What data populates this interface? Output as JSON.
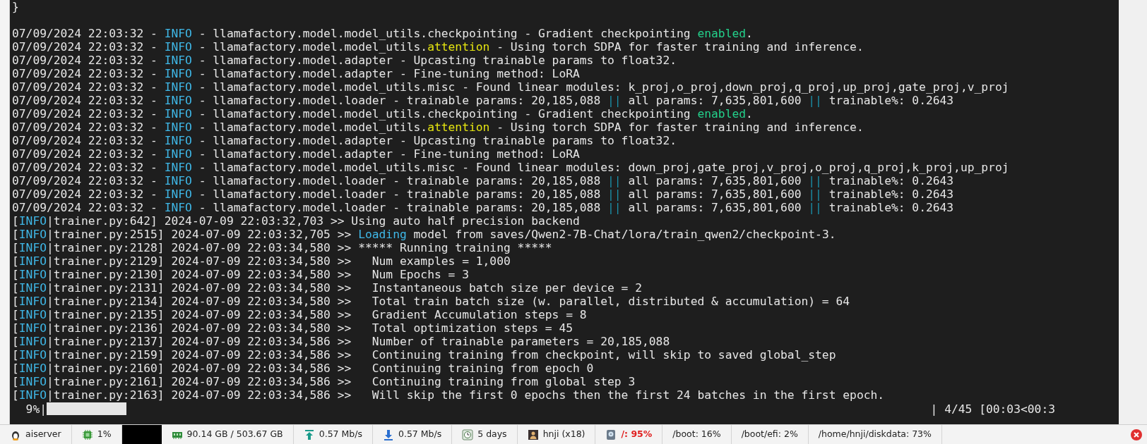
{
  "terminal": {
    "lines": [
      [
        {
          "text": "}",
          "kind": "plain"
        }
      ],
      [
        {
          "text": "07/09/2024 22:03:32 - ",
          "kind": "plain"
        },
        {
          "text": "INFO",
          "kind": "level"
        },
        {
          "text": " - llamafactory.model.model_utils.checkpointing - Gradient checkpointing ",
          "kind": "plain"
        },
        {
          "text": "enabled",
          "kind": "success"
        },
        {
          "text": ".",
          "kind": "plain"
        }
      ],
      [
        {
          "text": "07/09/2024 22:03:32 - ",
          "kind": "plain"
        },
        {
          "text": "INFO",
          "kind": "level"
        },
        {
          "text": " - llamafactory.model.model_utils.",
          "kind": "plain"
        },
        {
          "text": "attention",
          "kind": "highlight"
        },
        {
          "text": " - Using torch SDPA for faster training and inference.",
          "kind": "plain"
        }
      ],
      [
        {
          "text": "07/09/2024 22:03:32 - ",
          "kind": "plain"
        },
        {
          "text": "INFO",
          "kind": "level"
        },
        {
          "text": " - llamafactory.model.adapter - Upcasting trainable params to float32.",
          "kind": "plain"
        }
      ],
      [
        {
          "text": "07/09/2024 22:03:32 - ",
          "kind": "plain"
        },
        {
          "text": "INFO",
          "kind": "level"
        },
        {
          "text": " - llamafactory.model.adapter - Fine-tuning method: LoRA",
          "kind": "plain"
        }
      ],
      [
        {
          "text": "07/09/2024 22:03:32 - ",
          "kind": "plain"
        },
        {
          "text": "INFO",
          "kind": "level"
        },
        {
          "text": " - llamafactory.model.model_utils.misc - Found linear modules: k_proj,o_proj,down_proj,q_proj,up_proj,gate_proj,v_proj",
          "kind": "plain"
        }
      ],
      [
        {
          "text": "07/09/2024 22:03:32 - ",
          "kind": "plain"
        },
        {
          "text": "INFO",
          "kind": "level"
        },
        {
          "text": " - llamafactory.model.loader - trainable params: 20,185,088 ",
          "kind": "plain"
        },
        {
          "text": "||",
          "kind": "separator"
        },
        {
          "text": " all params: 7,635,801,600 ",
          "kind": "plain"
        },
        {
          "text": "||",
          "kind": "separator"
        },
        {
          "text": " trainable%: 0.2643",
          "kind": "plain"
        }
      ],
      [
        {
          "text": "07/09/2024 22:03:32 - ",
          "kind": "plain"
        },
        {
          "text": "INFO",
          "kind": "level"
        },
        {
          "text": " - llamafactory.model.model_utils.checkpointing - Gradient checkpointing ",
          "kind": "plain"
        },
        {
          "text": "enabled",
          "kind": "success"
        },
        {
          "text": ".",
          "kind": "plain"
        }
      ],
      [
        {
          "text": "07/09/2024 22:03:32 - ",
          "kind": "plain"
        },
        {
          "text": "INFO",
          "kind": "level"
        },
        {
          "text": " - llamafactory.model.model_utils.",
          "kind": "plain"
        },
        {
          "text": "attention",
          "kind": "highlight"
        },
        {
          "text": " - Using torch SDPA for faster training and inference.",
          "kind": "plain"
        }
      ],
      [
        {
          "text": "07/09/2024 22:03:32 - ",
          "kind": "plain"
        },
        {
          "text": "INFO",
          "kind": "level"
        },
        {
          "text": " - llamafactory.model.adapter - Upcasting trainable params to float32.",
          "kind": "plain"
        }
      ],
      [
        {
          "text": "07/09/2024 22:03:32 - ",
          "kind": "plain"
        },
        {
          "text": "INFO",
          "kind": "level"
        },
        {
          "text": " - llamafactory.model.adapter - Fine-tuning method: LoRA",
          "kind": "plain"
        }
      ],
      [
        {
          "text": "07/09/2024 22:03:32 - ",
          "kind": "plain"
        },
        {
          "text": "INFO",
          "kind": "level"
        },
        {
          "text": " - llamafactory.model.model_utils.misc - Found linear modules: down_proj,gate_proj,v_proj,o_proj,q_proj,k_proj,up_proj",
          "kind": "plain"
        }
      ],
      [
        {
          "text": "07/09/2024 22:03:32 - ",
          "kind": "plain"
        },
        {
          "text": "INFO",
          "kind": "level"
        },
        {
          "text": " - llamafactory.model.loader - trainable params: 20,185,088 ",
          "kind": "plain"
        },
        {
          "text": "||",
          "kind": "separator"
        },
        {
          "text": " all params: 7,635,801,600 ",
          "kind": "plain"
        },
        {
          "text": "||",
          "kind": "separator"
        },
        {
          "text": " trainable%: 0.2643",
          "kind": "plain"
        }
      ],
      [
        {
          "text": "07/09/2024 22:03:32 - ",
          "kind": "plain"
        },
        {
          "text": "INFO",
          "kind": "level"
        },
        {
          "text": " - llamafactory.model.loader - trainable params: 20,185,088 ",
          "kind": "plain"
        },
        {
          "text": "||",
          "kind": "separator"
        },
        {
          "text": " all params: 7,635,801,600 ",
          "kind": "plain"
        },
        {
          "text": "||",
          "kind": "separator"
        },
        {
          "text": " trainable%: 0.2643",
          "kind": "plain"
        }
      ],
      [
        {
          "text": "07/09/2024 22:03:32 - ",
          "kind": "plain"
        },
        {
          "text": "INFO",
          "kind": "level"
        },
        {
          "text": " - llamafactory.model.loader - trainable params: 20,185,088 ",
          "kind": "plain"
        },
        {
          "text": "||",
          "kind": "separator"
        },
        {
          "text": " all params: 7,635,801,600 ",
          "kind": "plain"
        },
        {
          "text": "||",
          "kind": "separator"
        },
        {
          "text": " trainable%: 0.2643",
          "kind": "plain"
        }
      ],
      [
        {
          "text": "[",
          "kind": "plain"
        },
        {
          "text": "INFO",
          "kind": "level"
        },
        {
          "text": "|trainer.py:642] 2024-07-09 22:03:32,703 >> Using auto half precision backend",
          "kind": "plain"
        }
      ],
      [
        {
          "text": "[",
          "kind": "plain"
        },
        {
          "text": "INFO",
          "kind": "level"
        },
        {
          "text": "|trainer.py:2515] 2024-07-09 22:03:32,705 >> ",
          "kind": "plain"
        },
        {
          "text": "Loading",
          "kind": "level"
        },
        {
          "text": " model from saves/Qwen2-7B-Chat/lora/train_qwen2/checkpoint-3.",
          "kind": "plain"
        }
      ],
      [
        {
          "text": "[",
          "kind": "plain"
        },
        {
          "text": "INFO",
          "kind": "level"
        },
        {
          "text": "|trainer.py:2128] 2024-07-09 22:03:34,580 >> ***** Running training *****",
          "kind": "plain"
        }
      ],
      [
        {
          "text": "[",
          "kind": "plain"
        },
        {
          "text": "INFO",
          "kind": "level"
        },
        {
          "text": "|trainer.py:2129] 2024-07-09 22:03:34,580 >>   Num examples = 1,000",
          "kind": "plain"
        }
      ],
      [
        {
          "text": "[",
          "kind": "plain"
        },
        {
          "text": "INFO",
          "kind": "level"
        },
        {
          "text": "|trainer.py:2130] 2024-07-09 22:03:34,580 >>   Num Epochs = 3",
          "kind": "plain"
        }
      ],
      [
        {
          "text": "[",
          "kind": "plain"
        },
        {
          "text": "INFO",
          "kind": "level"
        },
        {
          "text": "|trainer.py:2131] 2024-07-09 22:03:34,580 >>   Instantaneous batch size per device = 2",
          "kind": "plain"
        }
      ],
      [
        {
          "text": "[",
          "kind": "plain"
        },
        {
          "text": "INFO",
          "kind": "level"
        },
        {
          "text": "|trainer.py:2134] 2024-07-09 22:03:34,580 >>   Total train batch size (w. parallel, distributed & accumulation) = 64",
          "kind": "plain"
        }
      ],
      [
        {
          "text": "[",
          "kind": "plain"
        },
        {
          "text": "INFO",
          "kind": "level"
        },
        {
          "text": "|trainer.py:2135] 2024-07-09 22:03:34,580 >>   Gradient Accumulation steps = 8",
          "kind": "plain"
        }
      ],
      [
        {
          "text": "[",
          "kind": "plain"
        },
        {
          "text": "INFO",
          "kind": "level"
        },
        {
          "text": "|trainer.py:2136] 2024-07-09 22:03:34,580 >>   Total optimization steps = 45",
          "kind": "plain"
        }
      ],
      [
        {
          "text": "[",
          "kind": "plain"
        },
        {
          "text": "INFO",
          "kind": "level"
        },
        {
          "text": "|trainer.py:2137] 2024-07-09 22:03:34,586 >>   Number of trainable parameters = 20,185,088",
          "kind": "plain"
        }
      ],
      [
        {
          "text": "[",
          "kind": "plain"
        },
        {
          "text": "INFO",
          "kind": "level"
        },
        {
          "text": "|trainer.py:2159] 2024-07-09 22:03:34,586 >>   Continuing training from checkpoint, will skip to saved global_step",
          "kind": "plain"
        }
      ],
      [
        {
          "text": "[",
          "kind": "plain"
        },
        {
          "text": "INFO",
          "kind": "level"
        },
        {
          "text": "|trainer.py:2160] 2024-07-09 22:03:34,586 >>   Continuing training from epoch 0",
          "kind": "plain"
        }
      ],
      [
        {
          "text": "[",
          "kind": "plain"
        },
        {
          "text": "INFO",
          "kind": "level"
        },
        {
          "text": "|trainer.py:2161] 2024-07-09 22:03:34,586 >>   Continuing training from global step 3",
          "kind": "plain"
        }
      ],
      [
        {
          "text": "[",
          "kind": "plain"
        },
        {
          "text": "INFO",
          "kind": "level"
        },
        {
          "text": "|trainer.py:2163] 2024-07-09 22:03:34,586 >>   Will skip the first 0 epochs then the first 24 batches in the first epoch.",
          "kind": "plain"
        }
      ]
    ],
    "progress": {
      "percent": "  9%|",
      "level": 0.09,
      "status": "| 4/45 [00:03<00:3"
    }
  },
  "taskbar": {
    "items": [
      {
        "kind": "host",
        "text": "aiserver",
        "warning": false
      },
      {
        "kind": "cpu",
        "text": "1%",
        "warning": false
      },
      {
        "kind": "graph"
      },
      {
        "kind": "memory",
        "text": "90.14 GB / 503.67 GB",
        "warning": false
      },
      {
        "kind": "upload",
        "text": "0.57 Mb/s",
        "warning": false
      },
      {
        "kind": "download",
        "text": "0.57 Mb/s",
        "warning": false
      },
      {
        "kind": "uptime",
        "text": "5 days",
        "warning": false
      },
      {
        "kind": "users",
        "text": "hnji (x18)",
        "warning": false
      },
      {
        "kind": "disk",
        "text": "/: 95%",
        "warning": true
      },
      {
        "kind": "mount",
        "text": "/boot: 16%",
        "warning": false
      },
      {
        "kind": "mount",
        "text": "/boot/efi: 2%",
        "warning": false
      },
      {
        "kind": "mount",
        "text": "/home/hnji/diskdata: 73%",
        "warning": false
      }
    ]
  }
}
